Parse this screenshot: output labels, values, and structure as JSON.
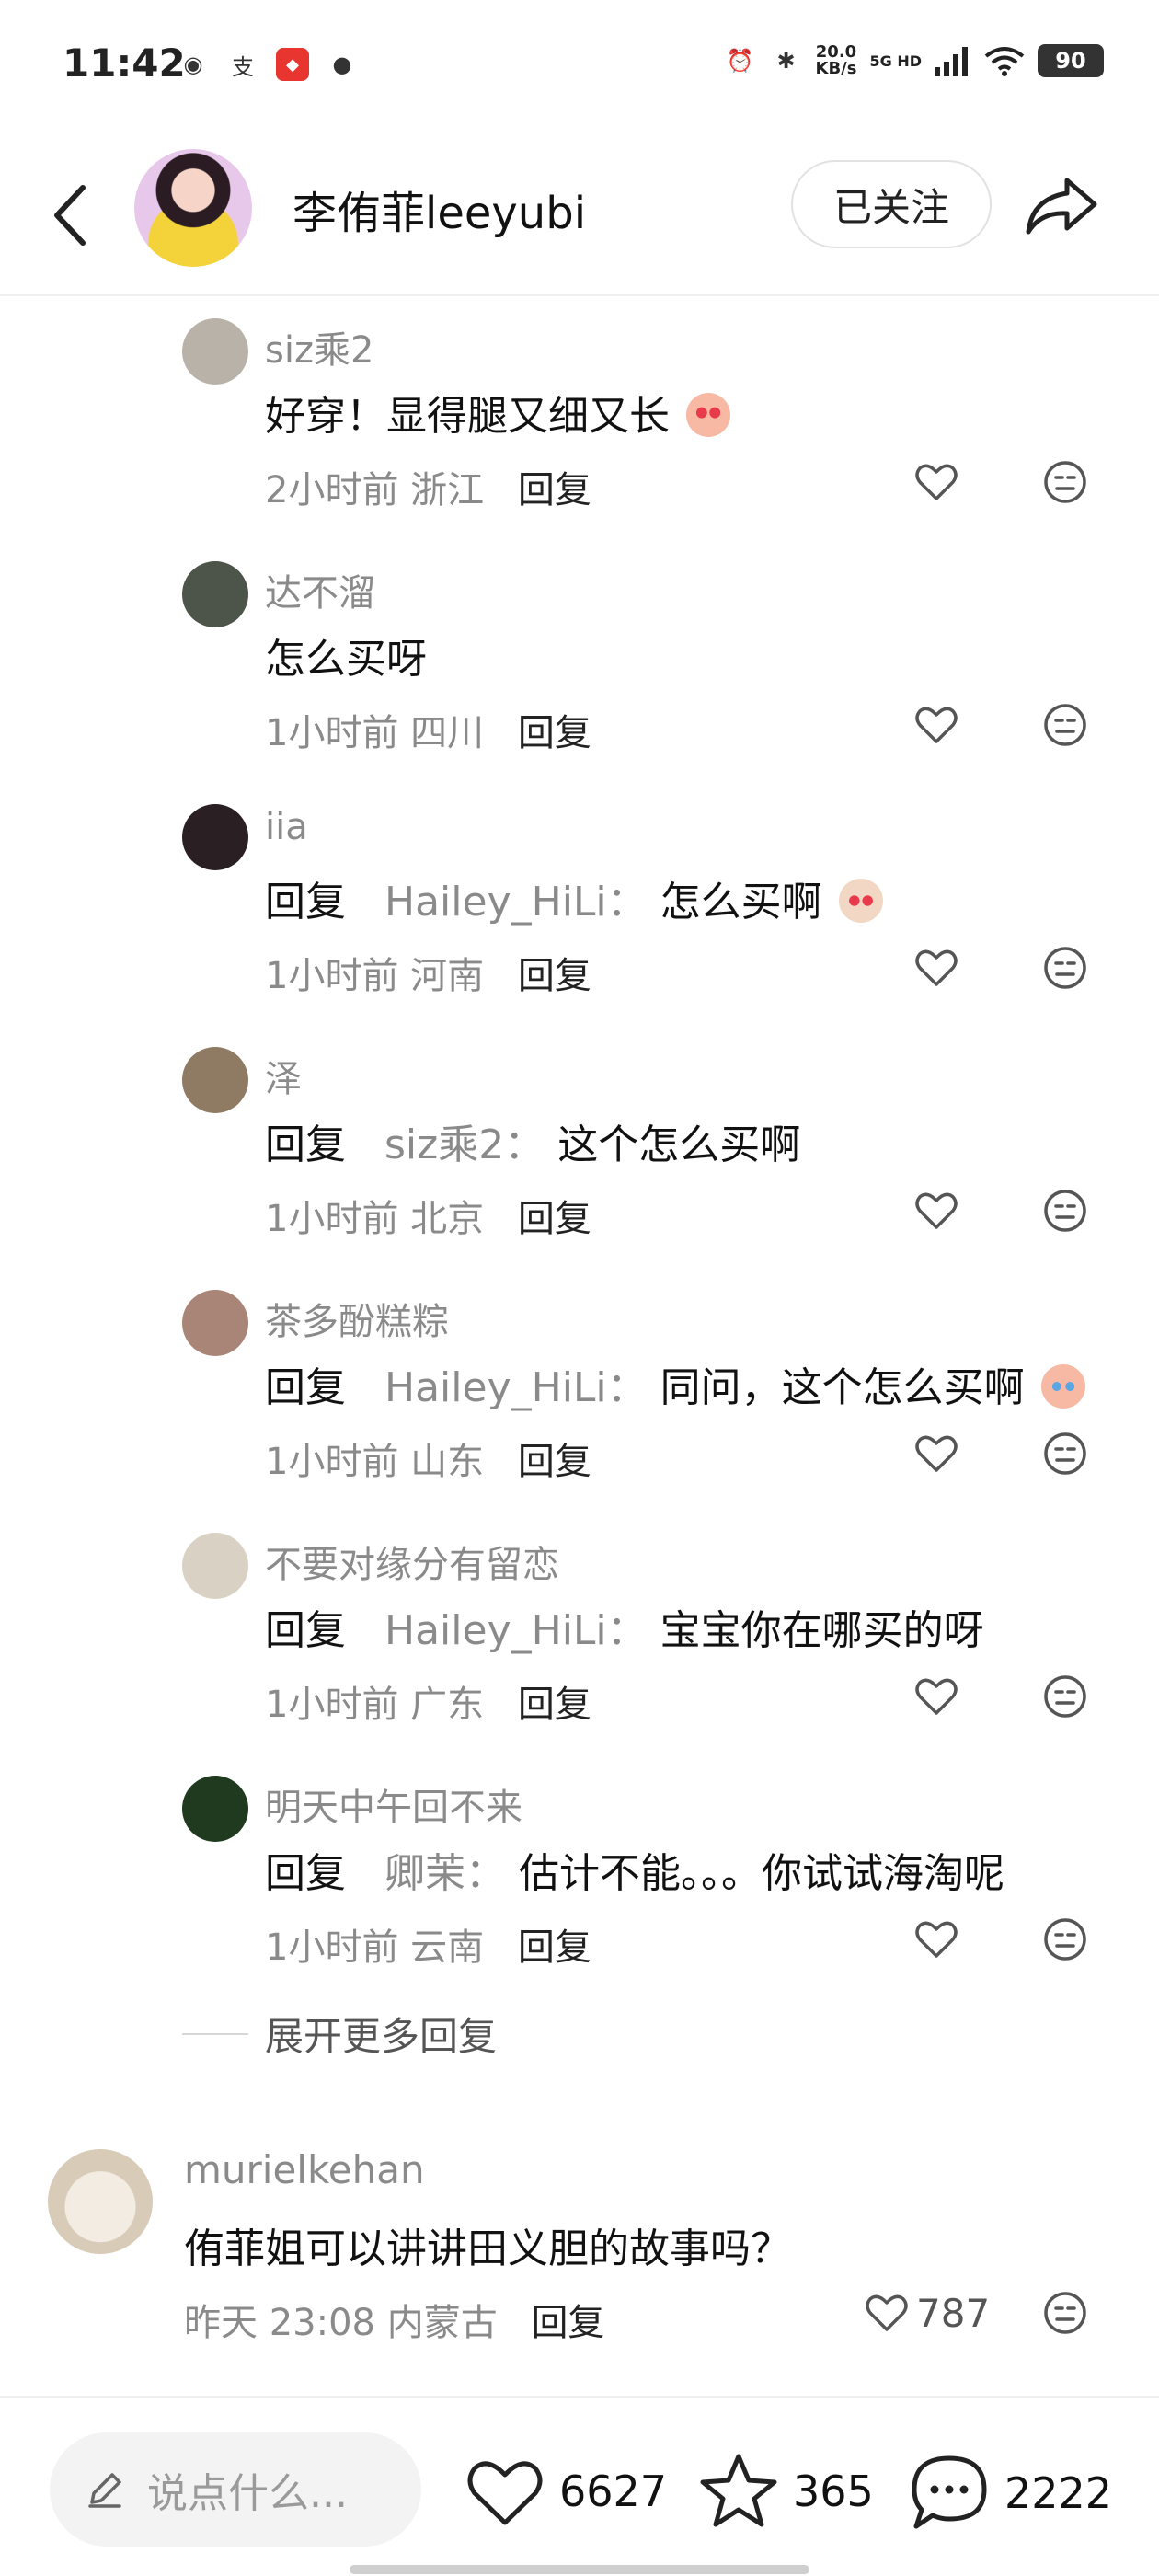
{
  "status_bar": {
    "time": "11:42",
    "speed_top": "20.0",
    "speed_bottom": "KB/s",
    "network": "5G HD",
    "battery": "90",
    "icons": [
      "globe-icon",
      "alipay-icon",
      "app-badge-icon",
      "wechat-icon",
      "alarm-icon",
      "bluetooth-icon",
      "signal-icon",
      "wifi-icon"
    ]
  },
  "header": {
    "title": "李侑菲leeyubi",
    "follow_label": "已关注"
  },
  "replies": [
    {
      "name": "siz乘2",
      "reply_prefix": "",
      "target": "",
      "text": "好穿！显得腿又细又长",
      "time": "2小时前",
      "location": "浙江",
      "reply_label": "回复",
      "emoji": "peach-heart-eyes",
      "avatar_color": "#b9b2a8"
    },
    {
      "name": "达不溜",
      "reply_prefix": "",
      "target": "",
      "text": "怎么买呀",
      "time": "1小时前",
      "location": "四川",
      "reply_label": "回复",
      "emoji": "",
      "avatar_color": "#4d5449"
    },
    {
      "name": "iia",
      "reply_prefix": "回复",
      "target": "Hailey_HiLi：",
      "text": "怎么买啊",
      "time": "1小时前",
      "location": "河南",
      "reply_label": "回复",
      "emoji": "cat-heart-eyes",
      "avatar_color": "#2a2024"
    },
    {
      "name": "泽",
      "reply_prefix": "回复",
      "target": "siz乘2：",
      "text": "这个怎么买啊",
      "time": "1小时前",
      "location": "北京",
      "reply_label": "回复",
      "emoji": "",
      "avatar_color": "#8f7a63"
    },
    {
      "name": "茶多酚糕粽",
      "reply_prefix": "回复",
      "target": "Hailey_HiLi：",
      "text": "同问，这个怎么买啊",
      "time": "1小时前",
      "location": "山东",
      "reply_label": "回复",
      "emoji": "peach-crying",
      "avatar_color": "#a88576"
    },
    {
      "name": "不要对缘分有留恋",
      "reply_prefix": "回复",
      "target": "Hailey_HiLi：",
      "text": "宝宝你在哪买的呀",
      "time": "1小时前",
      "location": "广东",
      "reply_label": "回复",
      "emoji": "",
      "avatar_color": "#d9d2c4"
    },
    {
      "name": "明天中午回不来",
      "reply_prefix": "回复",
      "target": "卿茉：",
      "text": "估计不能。。。你试试海淘呢",
      "time": "1小时前",
      "location": "云南",
      "reply_label": "回复",
      "emoji": "",
      "avatar_color": "#1f3a1f"
    }
  ],
  "expand_label": "展开更多回复",
  "comment": {
    "name": "murielkehan",
    "text": "侑菲姐可以讲讲田义胆的故事吗？",
    "time": "昨天 23:08",
    "location": "内蒙古",
    "reply_label": "回复",
    "likes": "787"
  },
  "bottom_bar": {
    "placeholder": "说点什么...",
    "likes": "6627",
    "favorites": "365",
    "comments": "2222"
  }
}
